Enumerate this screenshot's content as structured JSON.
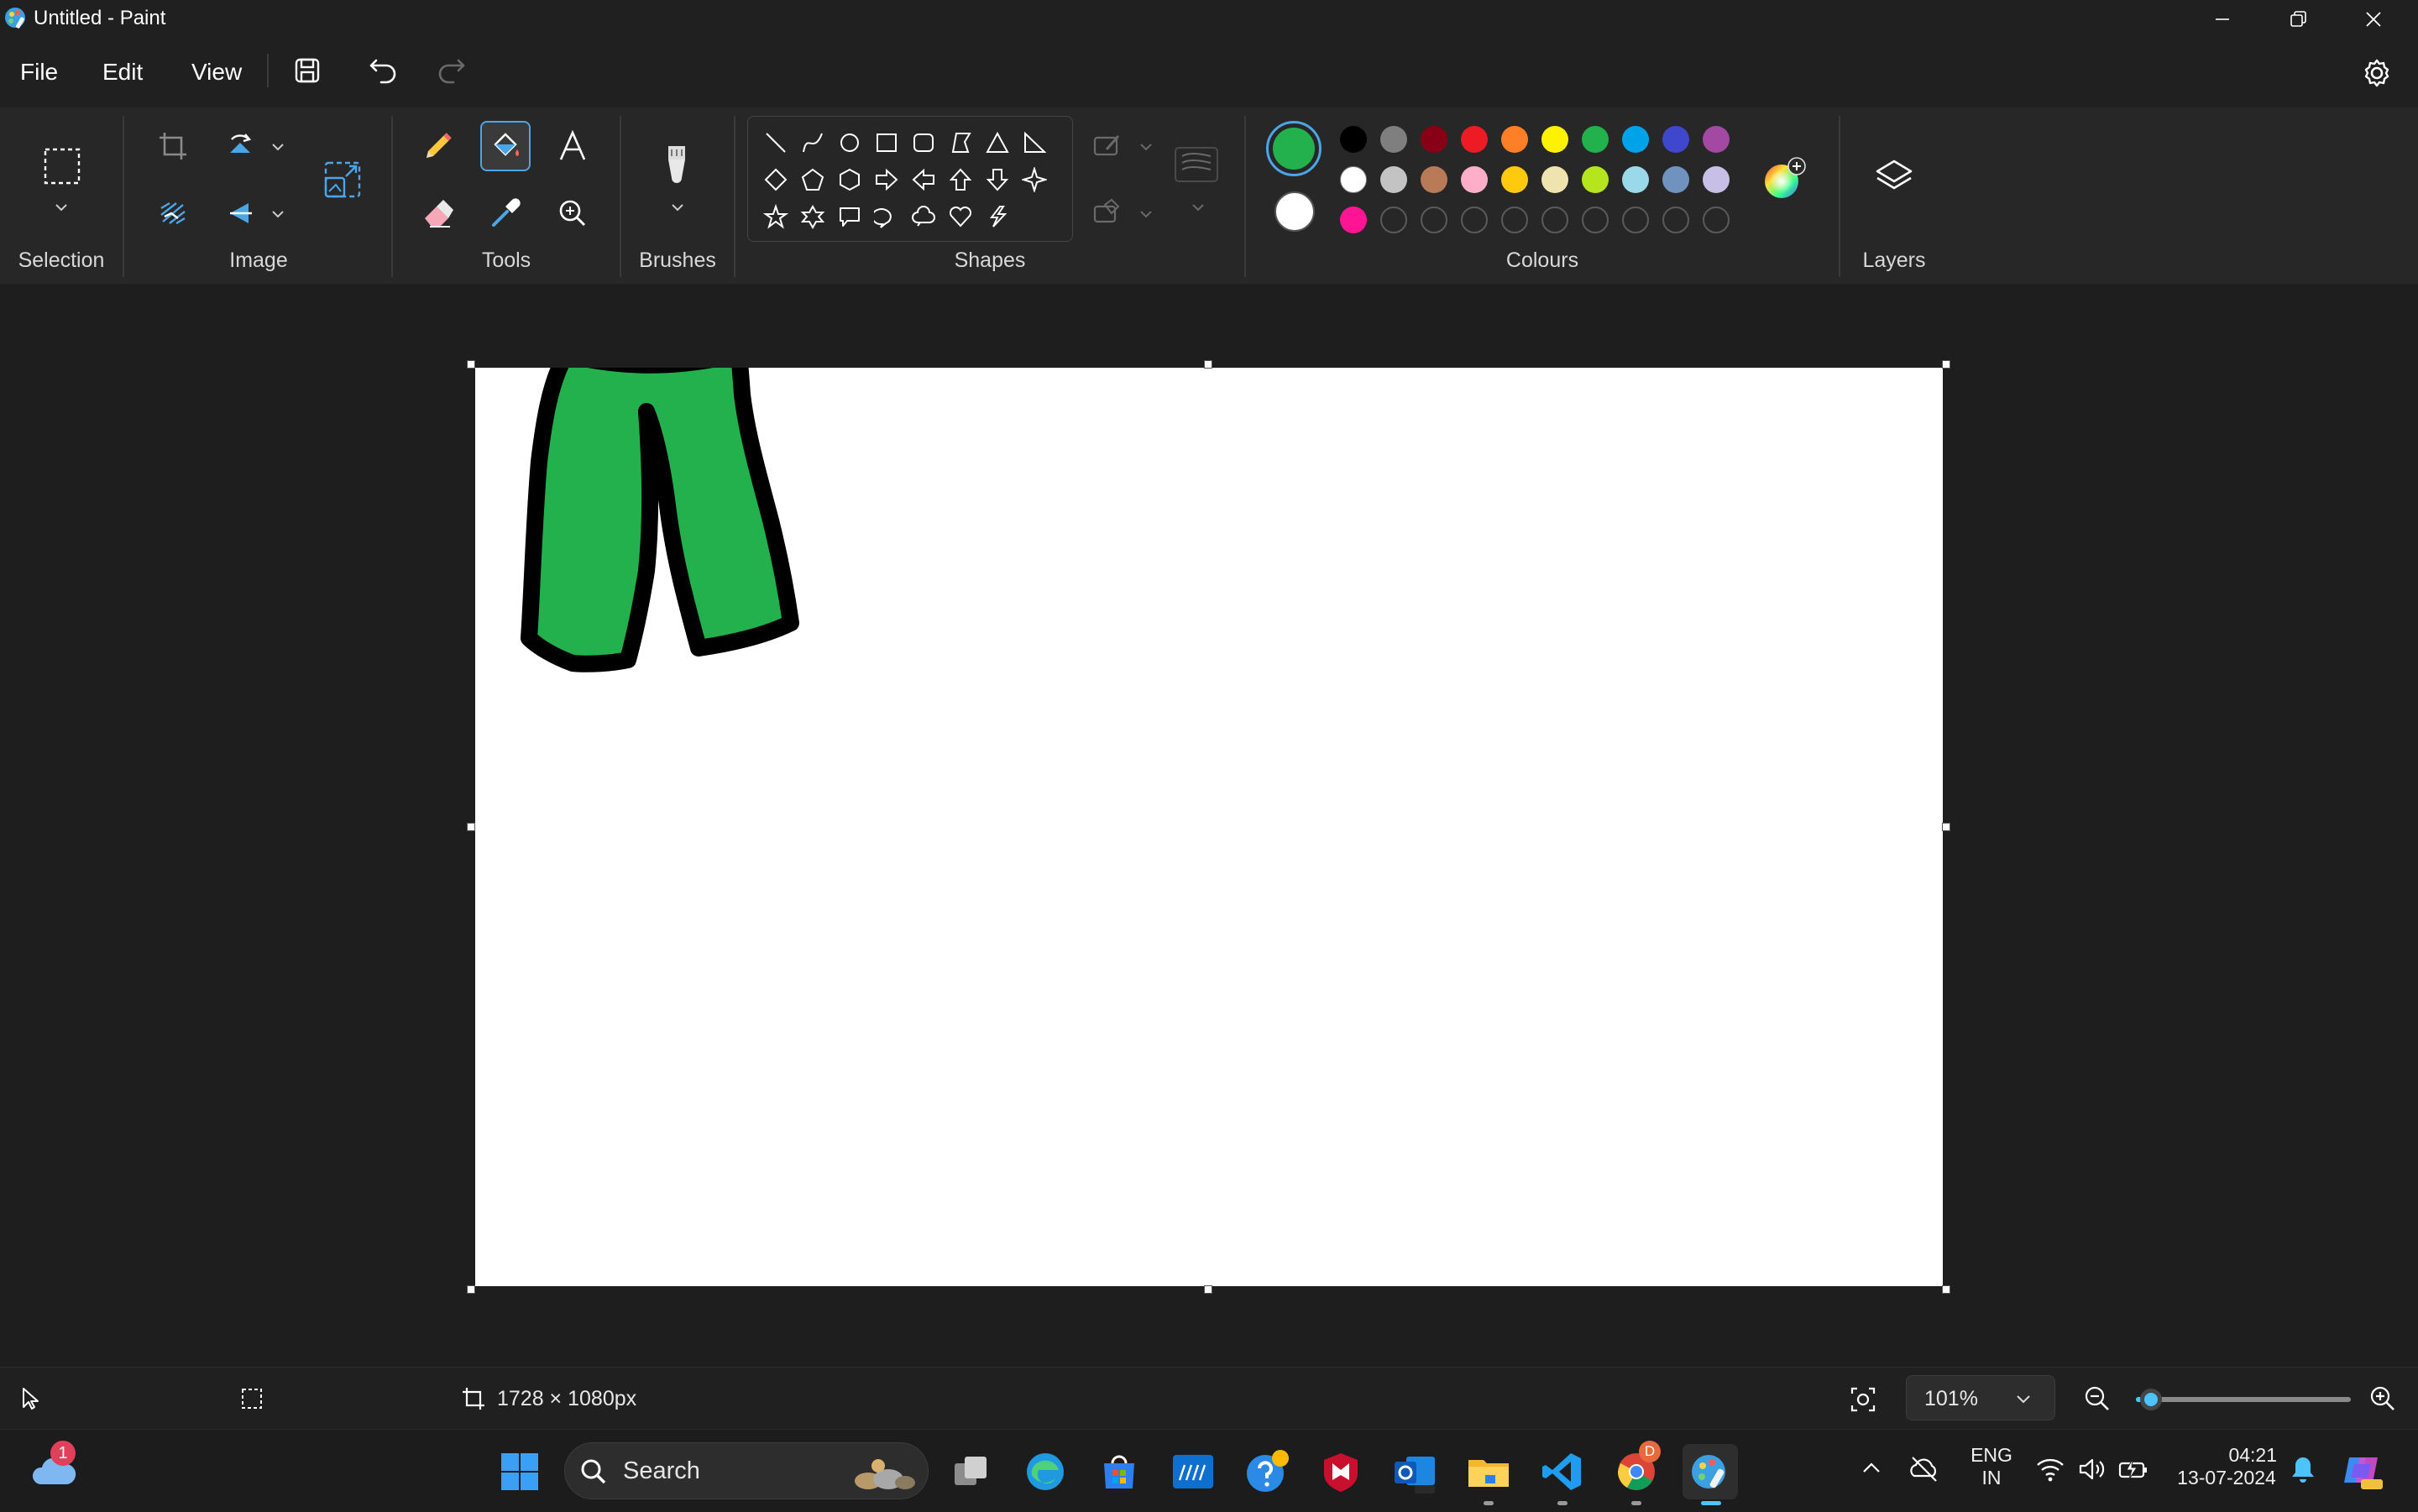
{
  "window": {
    "title": "Untitled - Paint"
  },
  "menu": {
    "file": "File",
    "edit": "Edit",
    "view": "View"
  },
  "ribbon": {
    "groups": {
      "selection": "Selection",
      "image": "Image",
      "tools": "Tools",
      "brushes": "Brushes",
      "shapes": "Shapes",
      "colours": "Colours",
      "layers": "Layers"
    },
    "active_tool": "fill-icon",
    "primary_colour": "#22b14c",
    "secondary_colour": "#ffffff",
    "palette": [
      [
        "#000000",
        "#7f7f7f",
        "#880015",
        "#ed1c24",
        "#ff7f27",
        "#fff200",
        "#22b14c",
        "#00a2e8",
        "#3f48cc",
        "#a349a4"
      ],
      [
        "#ffffff",
        "#c3c3c3",
        "#b97a57",
        "#ffaec9",
        "#ffc90e",
        "#efe4b0",
        "#b5e61d",
        "#99d9ea",
        "#7092be",
        "#c8bfe7"
      ],
      [
        "#ff1493",
        "",
        "",
        "",
        "",
        "",
        "",
        "",
        "",
        ""
      ]
    ]
  },
  "canvas": {
    "background": "#ffffff",
    "drawing": "green pants with black outline",
    "fill_colour": "#22b14c",
    "outline_colour": "#000000"
  },
  "status": {
    "canvas_size": "1728 × 1080px",
    "zoom": "101%",
    "zoom_slider_level": 0.07
  },
  "taskbar": {
    "search_label": "Search",
    "weather_badge": "1",
    "chrome_badge": "D",
    "language_line1": "ENG",
    "language_line2": "IN",
    "time": "04:21",
    "date": "13-07-2024"
  }
}
